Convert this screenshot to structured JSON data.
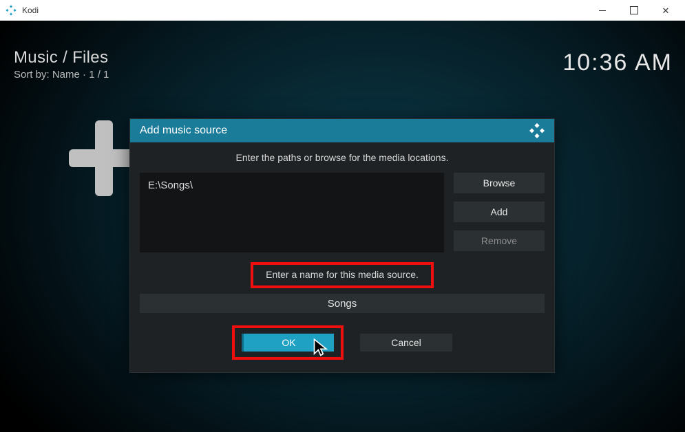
{
  "app": {
    "name": "Kodi"
  },
  "breadcrumb": {
    "path": "Music / Files",
    "sort": "Sort by: Name  ·  1 / 1"
  },
  "clock": "10:36 AM",
  "dialog": {
    "title": "Add music source",
    "description": "Enter the paths or browse for the media locations.",
    "path_value": "E:\\Songs\\",
    "buttons": {
      "browse": "Browse",
      "add": "Add",
      "remove": "Remove"
    },
    "name_label": "Enter a name for this media source.",
    "name_value": "Songs",
    "ok": "OK",
    "cancel": "Cancel"
  }
}
